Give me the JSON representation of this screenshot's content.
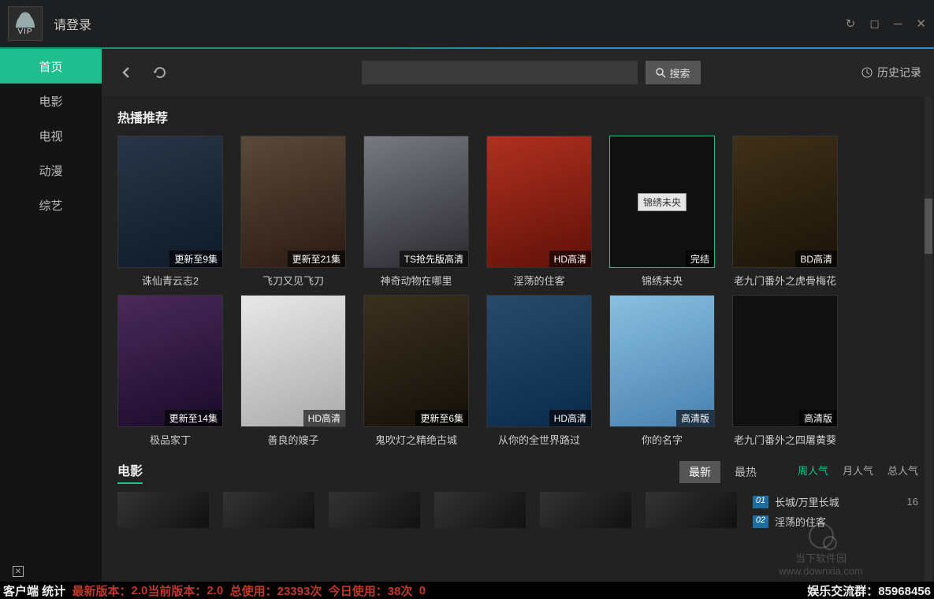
{
  "titlebar": {
    "vip_text": "VIP",
    "login_text": "请登录"
  },
  "sidebar": {
    "items": [
      {
        "label": "首页",
        "active": true
      },
      {
        "label": "电影",
        "active": false
      },
      {
        "label": "电视",
        "active": false
      },
      {
        "label": "动漫",
        "active": false
      },
      {
        "label": "综艺",
        "active": false
      }
    ]
  },
  "toolbar": {
    "search_placeholder": "",
    "search_button": "搜索",
    "history": "历史记录"
  },
  "section_hot": {
    "title": "热播推荐",
    "cards": [
      {
        "title": "诛仙青云志2",
        "tag": "更新至9集"
      },
      {
        "title": "飞刀又见飞刀",
        "tag": "更新至21集"
      },
      {
        "title": "神奇动物在哪里",
        "tag": "TS抢先版高清"
      },
      {
        "title": "淫荡的住客",
        "tag": "HD高清"
      },
      {
        "title": "锦绣未央",
        "tag": "完结",
        "highlighted": true,
        "placeholder_label": "锦绣未央"
      },
      {
        "title": "老九门番外之虎骨梅花",
        "tag": "BD高清"
      },
      {
        "title": "极品家丁",
        "tag": "更新至14集"
      },
      {
        "title": "善良的嫂子",
        "tag": "HD高清"
      },
      {
        "title": "鬼吹灯之精绝古城",
        "tag": "更新至6集"
      },
      {
        "title": "从你的全世界路过",
        "tag": "HD高清"
      },
      {
        "title": "你的名字",
        "tag": "高清版"
      },
      {
        "title": "老九门番外之四屠黄葵",
        "tag": "高清版"
      }
    ]
  },
  "section_movies": {
    "title": "电影",
    "filters": [
      {
        "label": "最新",
        "active": true
      },
      {
        "label": "最热",
        "active": false
      }
    ],
    "rank_tabs": [
      {
        "label": "周人气",
        "active": true
      },
      {
        "label": "月人气",
        "active": false
      },
      {
        "label": "总人气",
        "active": false
      }
    ],
    "rank_items": [
      {
        "num": "01",
        "title": "长城/万里长城",
        "count": "16"
      },
      {
        "num": "02",
        "title": "淫荡的住客",
        "count": ""
      }
    ]
  },
  "statusbar": {
    "left_label": "客户端 统计",
    "latest_version_label": "最新版本：",
    "latest_version": "2.0",
    "current_version_label": "当前版本：",
    "current_version": "2.0",
    "total_use_label": "总使用：",
    "total_use": "23393次",
    "today_use_label": "今日使用：",
    "today_use": "38次",
    "extra": "0",
    "right_label": "娱乐交流群：",
    "right_value": "85968456"
  },
  "watermark": {
    "text1": "当下软件园",
    "text2": "www.downxia.com"
  }
}
